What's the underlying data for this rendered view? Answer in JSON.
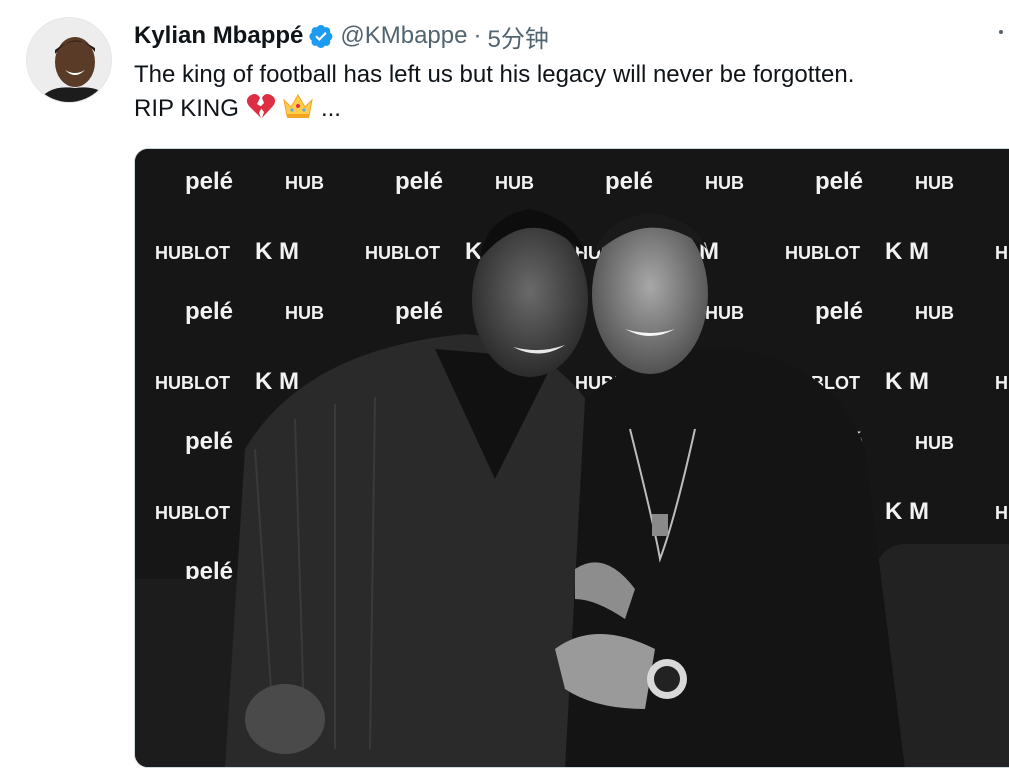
{
  "tweet": {
    "author_name": "Kylian Mbappé",
    "handle": "@KMbappe",
    "separator": "·",
    "time": "5分钟",
    "text_line1": "The king of football has left us but his legacy will never be forgotten.",
    "text_line2_prefix": "RIP KING",
    "text_line2_suffix": "...",
    "emojis": [
      "broken-heart-emoji",
      "crown-emoji"
    ]
  },
  "media": {
    "backdrop_logos": [
      "HUBLOT",
      "K M",
      "pelé"
    ]
  },
  "colors": {
    "verified_blue": "#1d9bf0",
    "secondary_text": "#536471",
    "primary_text": "#0f1419"
  }
}
